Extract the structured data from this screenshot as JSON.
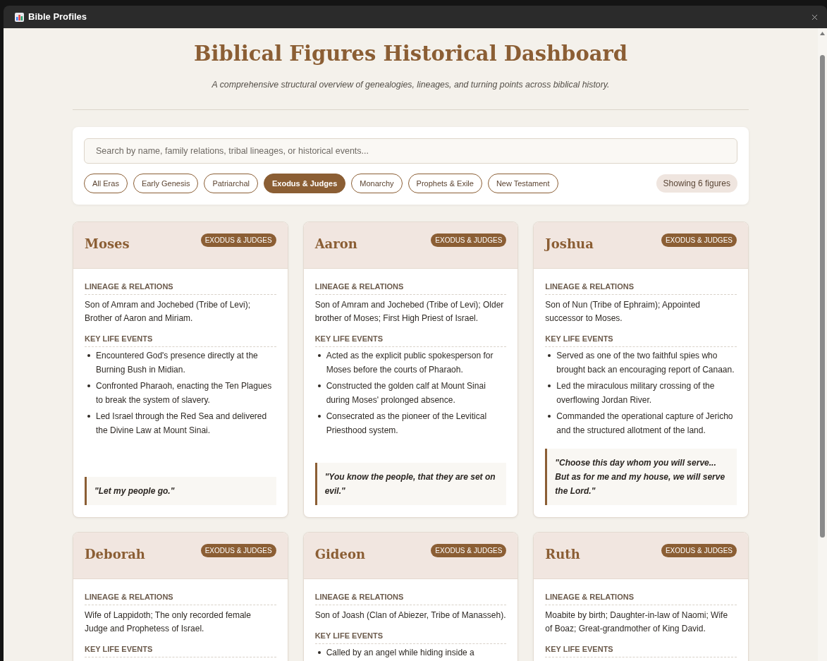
{
  "window": {
    "title": "Bible Profiles"
  },
  "header": {
    "title": "Biblical Figures Historical Dashboard",
    "subtitle": "A comprehensive structural overview of genealogies, lineages, and turning points across biblical history."
  },
  "search": {
    "placeholder": "Search by name, family relations, tribal lineages, or historical events..."
  },
  "filters": [
    {
      "label": "All Eras",
      "selected": false
    },
    {
      "label": "Early Genesis",
      "selected": false
    },
    {
      "label": "Patriarchal",
      "selected": false
    },
    {
      "label": "Exodus & Judges",
      "selected": true
    },
    {
      "label": "Monarchy",
      "selected": false
    },
    {
      "label": "Prophets & Exile",
      "selected": false
    },
    {
      "label": "New Testament",
      "selected": false
    }
  ],
  "result_count": "Showing 6 figures",
  "cards": [
    {
      "name": "Moses",
      "era": "EXODUS & JUDGES",
      "lineage_label": "LINEAGE & RELATIONS",
      "lineage": "Son of Amram and Jochebed (Tribe of Levi); Brother of Aaron and Miriam.",
      "events_label": "KEY LIFE EVENTS",
      "events": [
        "Encountered God's presence directly at the Burning Bush in Midian.",
        "Confronted Pharaoh, enacting the Ten Plagues to break the system of slavery.",
        "Led Israel through the Red Sea and delivered the Divine Law at Mount Sinai."
      ],
      "quote": "\"Let my people go.\""
    },
    {
      "name": "Aaron",
      "era": "EXODUS & JUDGES",
      "lineage_label": "LINEAGE & RELATIONS",
      "lineage": "Son of Amram and Jochebed (Tribe of Levi); Older brother of Moses; First High Priest of Israel.",
      "events_label": "KEY LIFE EVENTS",
      "events": [
        "Acted as the explicit public spokesperson for Moses before the courts of Pharaoh.",
        "Constructed the golden calf at Mount Sinai during Moses' prolonged absence.",
        "Consecrated as the pioneer of the Levitical Priesthood system."
      ],
      "quote": "\"You know the people, that they are set on evil.\""
    },
    {
      "name": "Joshua",
      "era": "EXODUS & JUDGES",
      "lineage_label": "LINEAGE & RELATIONS",
      "lineage": "Son of Nun (Tribe of Ephraim); Appointed successor to Moses.",
      "events_label": "KEY LIFE EVENTS",
      "events": [
        "Served as one of the two faithful spies who brought back an encouraging report of Canaan.",
        "Led the miraculous military crossing of the overflowing Jordan River.",
        "Commanded the operational capture of Jericho and the structured allotment of the land."
      ],
      "quote": "\"Choose this day whom you will serve... But as for me and my house, we will serve the Lord.\""
    },
    {
      "name": "Deborah",
      "era": "EXODUS & JUDGES",
      "lineage_label": "LINEAGE & RELATIONS",
      "lineage": "Wife of Lappidoth; The only recorded female Judge and Prophetess of Israel.",
      "events_label": "KEY LIFE EVENTS"
    },
    {
      "name": "Gideon",
      "era": "EXODUS & JUDGES",
      "lineage_label": "LINEAGE & RELATIONS",
      "lineage": "Son of Joash (Clan of Abiezer, Tribe of Manasseh).",
      "events_label": "KEY LIFE EVENTS",
      "events": [
        "Called by an angel while hiding inside a"
      ]
    },
    {
      "name": "Ruth",
      "era": "EXODUS & JUDGES",
      "lineage_label": "LINEAGE & RELATIONS",
      "lineage": "Moabite by birth; Daughter-in-law of Naomi; Wife of Boaz; Great-grandmother of King David.",
      "events_label": "KEY LIFE EVENTS"
    }
  ]
}
